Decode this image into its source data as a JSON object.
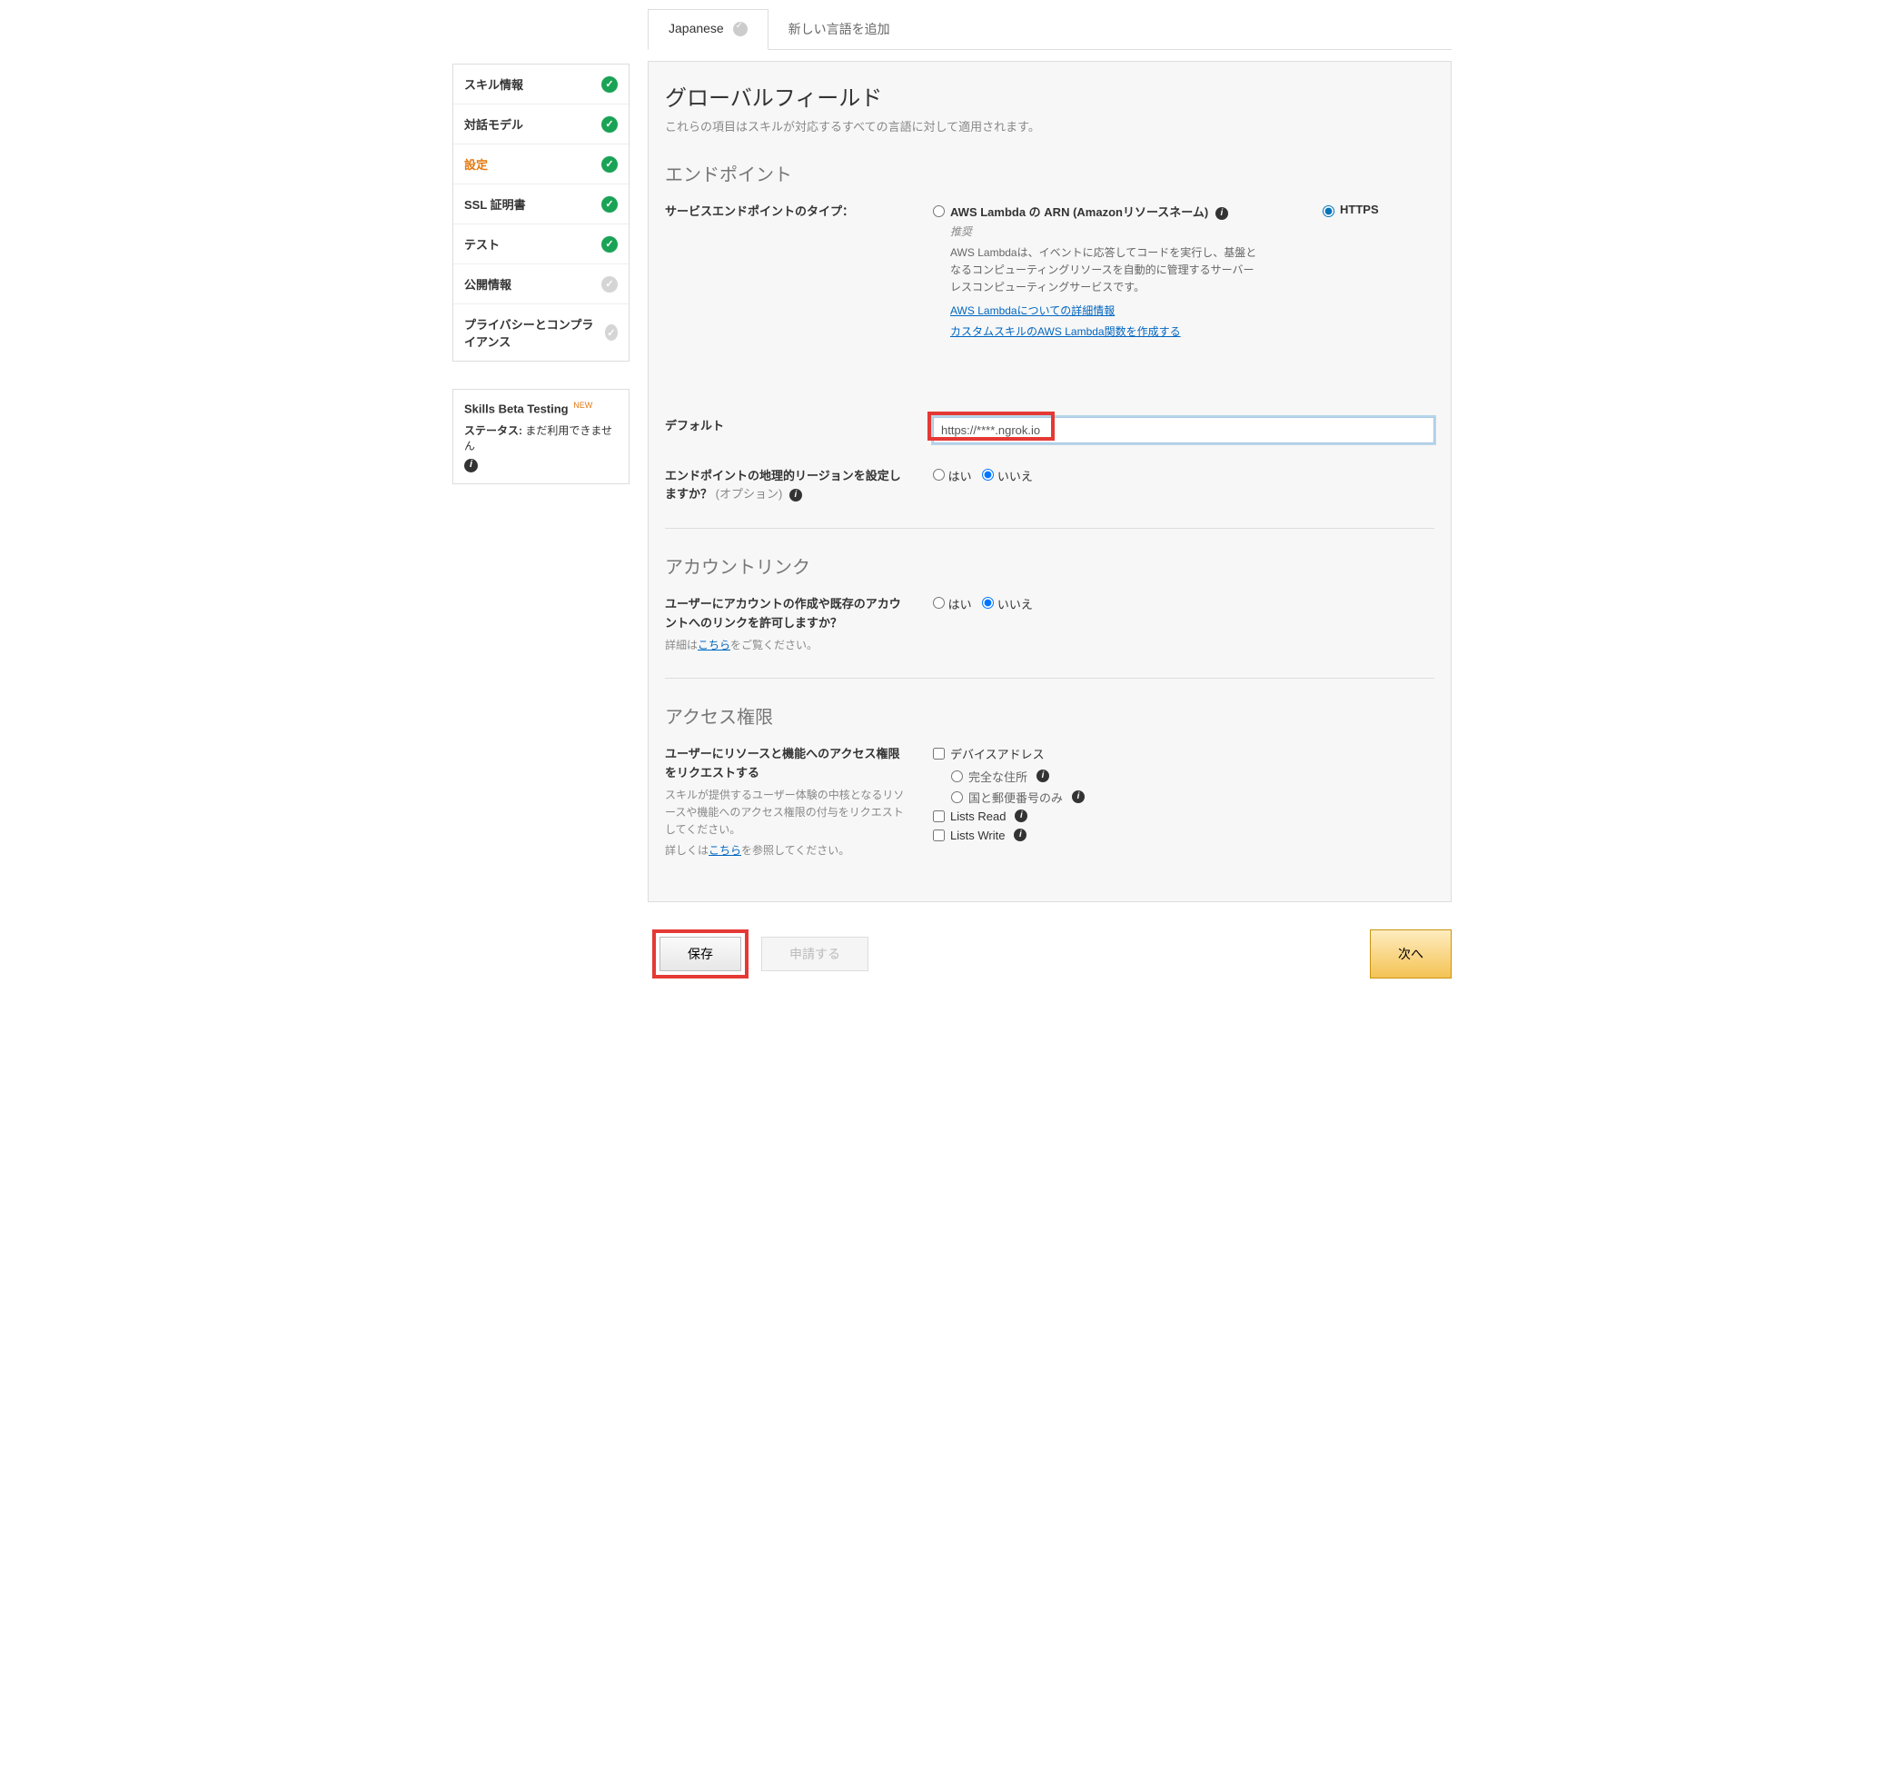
{
  "sidebar": {
    "items": [
      {
        "label": "スキル情報",
        "status": "ok"
      },
      {
        "label": "対話モデル",
        "status": "ok"
      },
      {
        "label": "設定",
        "status": "ok"
      },
      {
        "label": "SSL 証明書",
        "status": "ok"
      },
      {
        "label": "テスト",
        "status": "ok"
      },
      {
        "label": "公開情報",
        "status": "pending"
      },
      {
        "label": "プライバシーとコンプライアンス",
        "status": "pending"
      }
    ],
    "beta": {
      "title": "Skills Beta Testing",
      "new": "NEW",
      "status_label": "ステータス:",
      "status_value": "まだ利用できません"
    }
  },
  "tabs": {
    "active": "Japanese",
    "add": "新しい言語を追加"
  },
  "panel": {
    "global_title": "グローバルフィールド",
    "global_sub": "これらの項目はスキルが対応するすべての言語に対して適用されます。",
    "endpoint_title": "エンドポイント",
    "endpoint_type_label": "サービスエンドポイントのタイプ：",
    "lambda": {
      "title": "AWS Lambda の ARN (Amazonリソースネーム)",
      "reco": "推奨",
      "desc": "AWS Lambdaは、イベントに応答してコードを実行し、基盤となるコンピューティングリソースを自動的に管理するサーバーレスコンピューティングサービスです。",
      "link1": "AWS Lambdaについての詳細情報",
      "link2": "カスタムスキルのAWS Lambda関数を作成する"
    },
    "https_label": "HTTPS",
    "default_label": "デフォルト",
    "default_value": "https://****.ngrok.io",
    "geo_label": "エンドポイントの地理的リージョンを設定しますか？",
    "geo_opt": "(オプション)",
    "yes": "はい",
    "no": "いいえ",
    "account_title": "アカウントリンク",
    "account_label": "ユーザーにアカウントの作成や既存のアカウントへのリンクを許可しますか？",
    "account_help_prefix": "詳細は",
    "account_help_link": "こちら",
    "account_help_suffix": "をご覧ください。",
    "perm_title": "アクセス権限",
    "perm_label": "ユーザーにリソースと機能へのアクセス権限をリクエストする",
    "perm_help1": "スキルが提供するユーザー体験の中核となるリソースや機能へのアクセス権限の付与をリクエストしてください。",
    "perm_help2_prefix": "詳しくは",
    "perm_help2_link": "こちら",
    "perm_help2_suffix": "を参照してください。",
    "device_addr": "デバイスアドレス",
    "full_addr": "完全な住所",
    "country_zip": "国と郵便番号のみ",
    "lists_read": "Lists Read",
    "lists_write": "Lists Write"
  },
  "footer": {
    "save": "保存",
    "submit": "申請する",
    "next": "次へ"
  }
}
